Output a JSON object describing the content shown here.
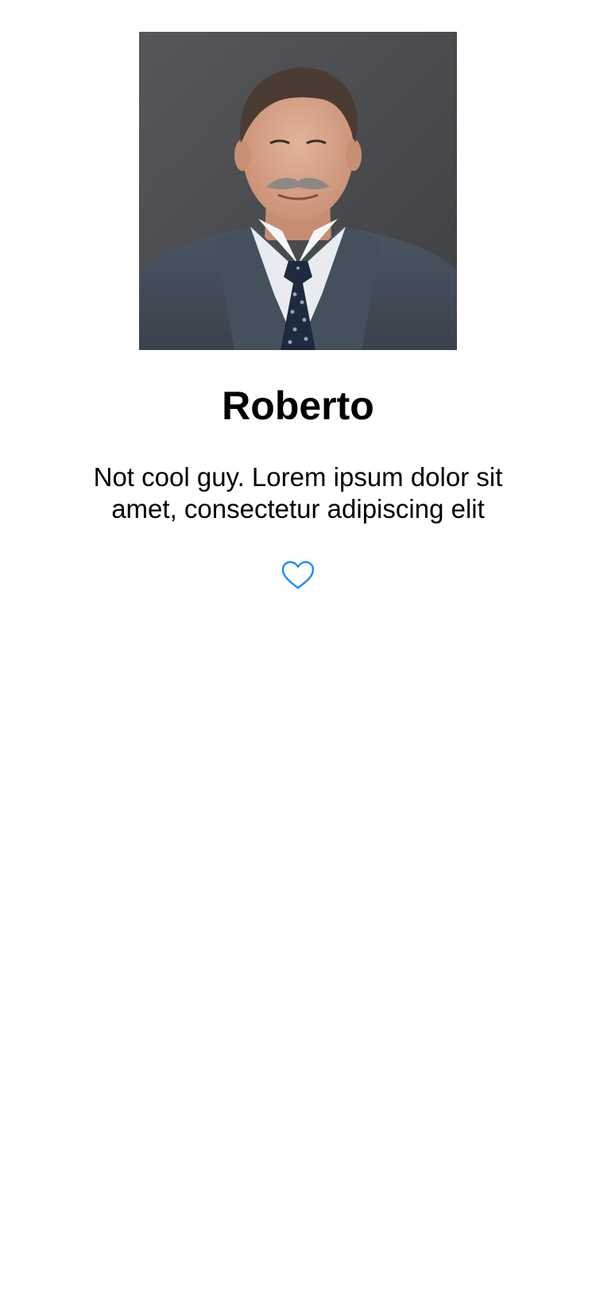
{
  "profile": {
    "name": "Roberto",
    "bio": "Not cool guy. Lorem ipsum dolor sit amet, consectetur adipiscing elit"
  },
  "actions": {
    "favorite_icon": "heart-outline-icon"
  },
  "colors": {
    "accent": "#1a8cff",
    "text": "#000000",
    "background": "#ffffff"
  }
}
